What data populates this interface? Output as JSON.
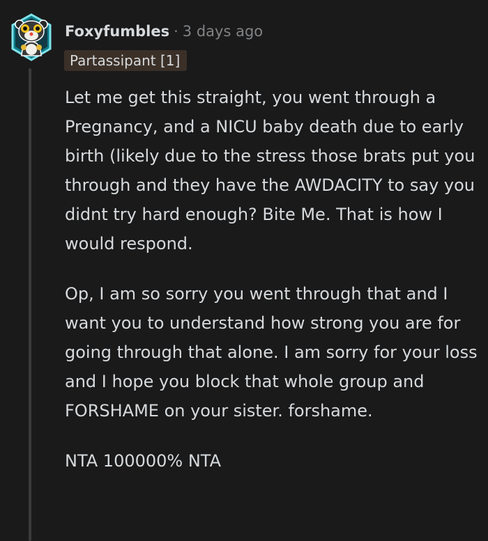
{
  "comment": {
    "username": "Foxyfumbles",
    "separator": "·",
    "timestamp": "3 days ago",
    "flair": "Partassipant [1]",
    "paragraphs": [
      "Let me get this straight, you went through a Pregnancy, and a NICU baby death due to early birth (likely due to the stress those brats put you through and they have the AWDACITY to say you didnt try hard enough? Bite Me. That is how I would respond.",
      "Op, I am so sorry you went through that and I want you to understand how strong you are for going through that alone. I am sorry for your loss and I hope you block that whole group and FORSHAME on your sister. forshame.",
      "NTA 100000% NTA"
    ]
  },
  "colors": {
    "background": "#1a1a1b",
    "text": "#d7dadc",
    "meta": "#818384",
    "flair_bg": "#3b3028",
    "thread_line": "#3a3a3b"
  },
  "icons": {
    "avatar": "snoo-avatar-icon"
  }
}
